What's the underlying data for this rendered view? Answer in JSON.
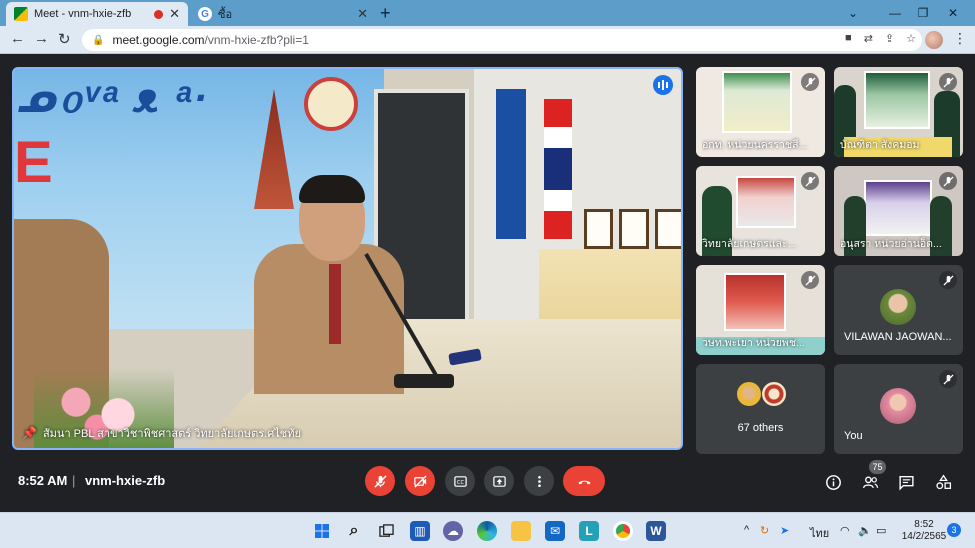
{
  "browser": {
    "tabs": [
      {
        "title": "Meet - vnm-hxie-zfb",
        "active": true
      },
      {
        "title": "ซื้อ",
        "active": false
      }
    ],
    "url_host": "meet.google.com",
    "url_path": "/vnm-hxie-zfb?pli=1"
  },
  "meet": {
    "main_speaker": {
      "name": "สัมนา PBL สาขาวิชาพิชศาสตร์ วิทยาลัยเกษตร.ศไชทัย"
    },
    "participants": [
      {
        "name": "อกท. หน่วยนครราชสี...",
        "muted": true
      },
      {
        "name": "บัณฑิตา สังคมอม",
        "muted": true
      },
      {
        "name": "วิทยาลัยเกษตรและ...",
        "muted": true
      },
      {
        "name": "อนุสรา หน่วยอ่านอ็ด...",
        "muted": true
      },
      {
        "name": "วษท.พะเยา หน่วยพช...",
        "muted": true
      },
      {
        "name": "VILAWAN JAOWAN...",
        "muted": true
      },
      {
        "name": "67 others",
        "muted": false
      },
      {
        "name": "You",
        "muted": true
      }
    ],
    "time": "8:52 AM",
    "separator": "|",
    "meeting_code": "vnm-hxie-zfb",
    "participant_count": "75"
  },
  "colors": {
    "end_call": "#ea4335",
    "active_speaker_border": "#8ab4f8",
    "meet_background": "#202124"
  },
  "taskbar": {
    "lang": "ไทย",
    "time": "8:52",
    "date": "14/2/2565",
    "notifications": "3"
  }
}
